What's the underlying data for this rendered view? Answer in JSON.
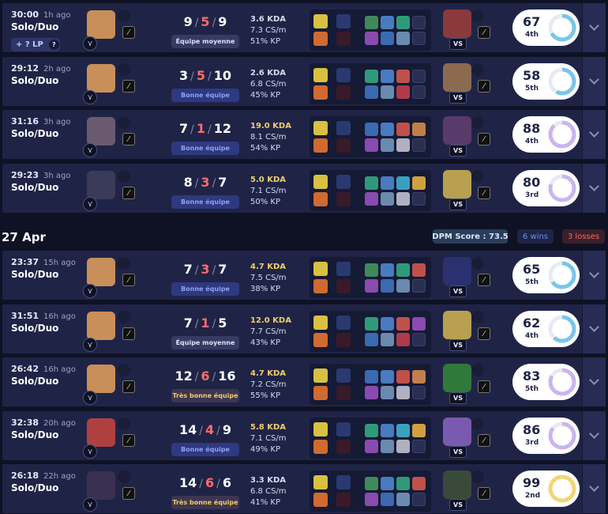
{
  "date_header": "27 Apr",
  "summary": {
    "dpm": "DPM Score : 73.5",
    "wins": "6 wins",
    "losses": "3 losses"
  },
  "colors": {
    "win_ring": "#77c6ec",
    "purple_ring": "#c9b5f0",
    "gold_ring": "#f3d675",
    "death_red": "#ff6b6b",
    "good_team": "#8ea2f4",
    "great_team": "#f2cc6a"
  },
  "lp_badge": {
    "label": "+ ? LP",
    "help": "?"
  },
  "vs_label": "VS",
  "matches": [
    {
      "time": "30:00",
      "ago": "1h ago",
      "queue": "Solo/Duo",
      "k": "9",
      "d": "5",
      "a": "9",
      "team": "Équipe moyenne",
      "team_kind": "moy",
      "kda": "3.6 KDA",
      "cs": "7.3 CS/m",
      "kp": "51% KP",
      "kda_gold": false,
      "score": "67",
      "rank": "4th",
      "ring": "win",
      "score_pct": 0.67,
      "lp": true,
      "champ_color": "#c98f5a",
      "opp_color": "#8a3a3a"
    },
    {
      "time": "29:12",
      "ago": "2h ago",
      "queue": "Solo/Duo",
      "k": "3",
      "d": "5",
      "a": "10",
      "team": "Bonne équipe",
      "team_kind": "bonne",
      "kda": "2.6 KDA",
      "cs": "6.8 CS/m",
      "kp": "45% KP",
      "kda_gold": false,
      "score": "58",
      "rank": "5th",
      "ring": "win",
      "score_pct": 0.58,
      "lp": false,
      "champ_color": "#c98f5a",
      "opp_color": "#8c6a50"
    },
    {
      "time": "31:16",
      "ago": "3h ago",
      "queue": "Solo/Duo",
      "k": "7",
      "d": "1",
      "a": "12",
      "team": "Bonne équipe",
      "team_kind": "bonne",
      "kda": "19.0 KDA",
      "cs": "8.1 CS/m",
      "kp": "54% KP",
      "kda_gold": true,
      "score": "88",
      "rank": "4th",
      "ring": "purple",
      "score_pct": 0.88,
      "lp": false,
      "champ_color": "#6a5a70",
      "opp_color": "#5a3a6a"
    },
    {
      "time": "29:23",
      "ago": "3h ago",
      "queue": "Solo/Duo",
      "k": "8",
      "d": "3",
      "a": "7",
      "team": "Bonne équipe",
      "team_kind": "bonne",
      "kda": "5.0 KDA",
      "cs": "7.1 CS/m",
      "kp": "50% KP",
      "kda_gold": true,
      "score": "80",
      "rank": "3rd",
      "ring": "purple",
      "score_pct": 0.8,
      "lp": false,
      "champ_color": "#3a3a5a",
      "opp_color": "#b8a050"
    },
    {
      "time": "23:37",
      "ago": "15h ago",
      "queue": "Solo/Duo",
      "k": "7",
      "d": "3",
      "a": "7",
      "team": "Bonne équipe",
      "team_kind": "bonne",
      "kda": "4.7 KDA",
      "cs": "7.5 CS/m",
      "kp": "38% KP",
      "kda_gold": true,
      "score": "65",
      "rank": "5th",
      "ring": "win",
      "score_pct": 0.65,
      "lp": false,
      "champ_color": "#c98f5a",
      "opp_color": "#2a3070"
    },
    {
      "time": "31:51",
      "ago": "16h ago",
      "queue": "Solo/Duo",
      "k": "7",
      "d": "1",
      "a": "5",
      "team": "Équipe moyenne",
      "team_kind": "moy",
      "kda": "12.0 KDA",
      "cs": "7.7 CS/m",
      "kp": "43% KP",
      "kda_gold": true,
      "score": "62",
      "rank": "4th",
      "ring": "win",
      "score_pct": 0.62,
      "lp": false,
      "champ_color": "#c98f5a",
      "opp_color": "#b8a050"
    },
    {
      "time": "26:42",
      "ago": "16h ago",
      "queue": "Solo/Duo",
      "k": "12",
      "d": "6",
      "a": "16",
      "team": "Très bonne équipe",
      "team_kind": "tres",
      "kda": "4.7 KDA",
      "cs": "7.2 CS/m",
      "kp": "55% KP",
      "kda_gold": true,
      "score": "83",
      "rank": "5th",
      "ring": "purple",
      "score_pct": 0.83,
      "lp": false,
      "champ_color": "#c98f5a",
      "opp_color": "#2f7a3a"
    },
    {
      "time": "32:38",
      "ago": "20h ago",
      "queue": "Solo/Duo",
      "k": "14",
      "d": "4",
      "a": "9",
      "team": "Bonne équipe",
      "team_kind": "bonne",
      "kda": "5.8 KDA",
      "cs": "7.1 CS/m",
      "kp": "49% KP",
      "kda_gold": true,
      "score": "86",
      "rank": "3rd",
      "ring": "purple",
      "score_pct": 0.86,
      "lp": false,
      "champ_color": "#b04040",
      "opp_color": "#7a5ab0"
    },
    {
      "time": "26:18",
      "ago": "22h ago",
      "queue": "Solo/Duo",
      "k": "14",
      "d": "6",
      "a": "6",
      "team": "Très bonne équipe",
      "team_kind": "tres",
      "kda": "3.3 KDA",
      "cs": "6.8 CS/m",
      "kp": "41% KP",
      "kda_gold": false,
      "score": "99",
      "rank": "2nd",
      "ring": "gold",
      "score_pct": 0.99,
      "lp": false,
      "champ_color": "#3a3050",
      "opp_color": "#3a4a3a"
    }
  ]
}
